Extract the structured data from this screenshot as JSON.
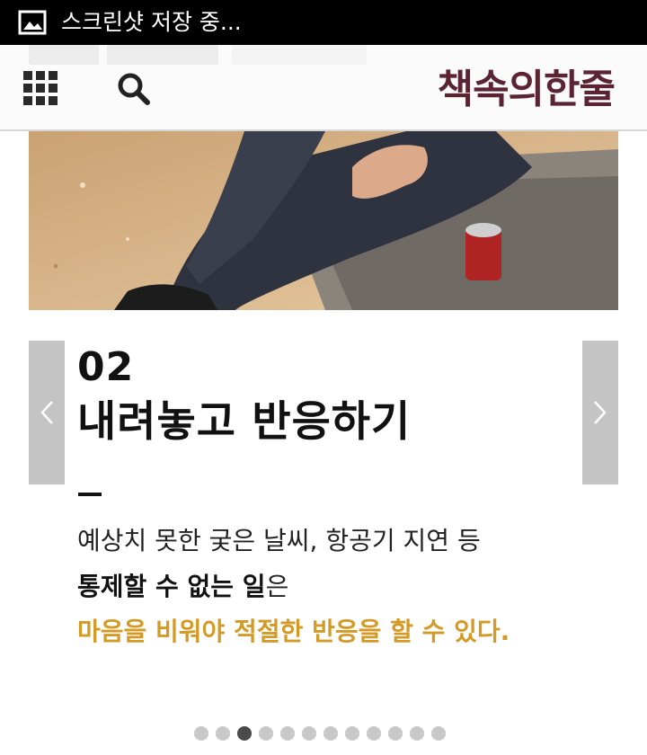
{
  "status_bar": {
    "icon": "image-icon",
    "text": "스크린샷 저장 중..."
  },
  "header": {
    "menu_icon": "grid-icon",
    "search_icon": "search-icon",
    "logo_text": "책속의한줄",
    "logo_color": "#5b2433"
  },
  "hero": {
    "description_icon": "photo-person-sitting-on-sand"
  },
  "slide": {
    "number": "02",
    "title": "내려놓고 반응하기",
    "line1": "예상치 못한 궂은 날씨, 항공기 지연 등",
    "line2_bold": "통제할 수 없는 일",
    "line2_rest": "은",
    "line3_accent": "마음을 비워야 적절한 반응을 할 수 있다.",
    "accent_color": "#d39a26"
  },
  "carousel": {
    "prev_icon": "chevron-left-icon",
    "next_icon": "chevron-right-icon",
    "page_count": 12,
    "active_index": 2
  }
}
